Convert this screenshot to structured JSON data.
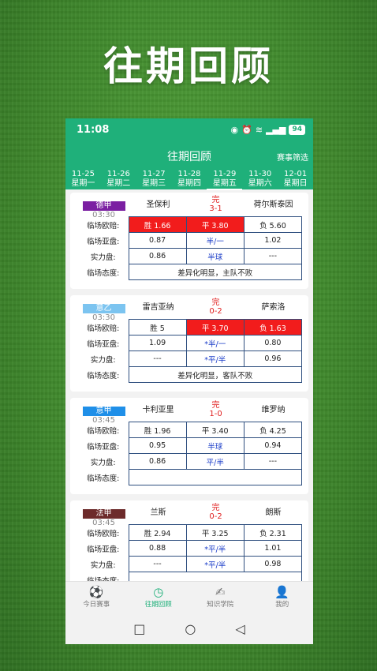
{
  "banner": {
    "title": "往期回顾"
  },
  "status": {
    "time": "11:08",
    "battery": "94"
  },
  "header": {
    "title": "往期回顾",
    "filter_label": "赛事筛选"
  },
  "dates": [
    {
      "date": "11-25",
      "week": "星期一"
    },
    {
      "date": "11-26",
      "week": "星期二"
    },
    {
      "date": "11-27",
      "week": "星期三"
    },
    {
      "date": "11-28",
      "week": "星期四"
    },
    {
      "date": "11-29",
      "week": "星期五"
    },
    {
      "date": "11-30",
      "week": "星期六"
    },
    {
      "date": "12-01",
      "week": "星期日"
    }
  ],
  "row_labels": {
    "euro": "临场欧赔:",
    "asia": "临场亚盘:",
    "power": "实力盘:",
    "attitude": "临场态度:"
  },
  "matches": [
    {
      "league": "德甲",
      "league_color": "#7b1fa2",
      "time": "03:30",
      "home": "圣保利",
      "status": "完",
      "score": "3-1",
      "away": "荷尔斯泰因",
      "euro": [
        "胜 1.66",
        "平 3.80",
        "负 5.60"
      ],
      "asia": [
        "0.87",
        "半/一",
        "1.02"
      ],
      "power": [
        "0.86",
        "半球",
        "---"
      ],
      "attitude": "差异化明显，主队不败"
    },
    {
      "league": "意乙",
      "league_color": "#7cc4f0",
      "time": "03:30",
      "home": "雷吉亚纳",
      "status": "完",
      "score": "0-2",
      "away": "萨索洛",
      "euro": [
        "胜 5",
        "平 3.70",
        "负 1.63"
      ],
      "asia": [
        "1.09",
        "*半/一",
        "0.80"
      ],
      "power": [
        "---",
        "*平/半",
        "0.96"
      ],
      "attitude": "差异化明显，客队不败"
    },
    {
      "league": "意甲",
      "league_color": "#1f8fe8",
      "time": "03:45",
      "home": "卡利亚里",
      "status": "完",
      "score": "1-0",
      "away": "维罗纳",
      "euro": [
        "胜 1.96",
        "平 3.40",
        "负 4.25"
      ],
      "asia": [
        "0.95",
        "半球",
        "0.94"
      ],
      "power": [
        "0.86",
        "平/半",
        "---"
      ],
      "attitude": ""
    },
    {
      "league": "法甲",
      "league_color": "#6d2b2b",
      "time": "03:45",
      "home": "兰斯",
      "status": "完",
      "score": "0-2",
      "away": "朗斯",
      "euro": [
        "胜 2.94",
        "平 3.25",
        "负 2.31"
      ],
      "asia": [
        "0.88",
        "*平/半",
        "1.01"
      ],
      "power": [
        "---",
        "*平/半",
        "0.98"
      ],
      "attitude": ""
    }
  ],
  "tabs": [
    {
      "label": "今日赛事",
      "icon": "soccer-ball-icon"
    },
    {
      "label": "往期回顾",
      "icon": "history-clock-icon"
    },
    {
      "label": "知识学院",
      "icon": "book-pen-icon"
    },
    {
      "label": "我的",
      "icon": "user-icon"
    }
  ]
}
